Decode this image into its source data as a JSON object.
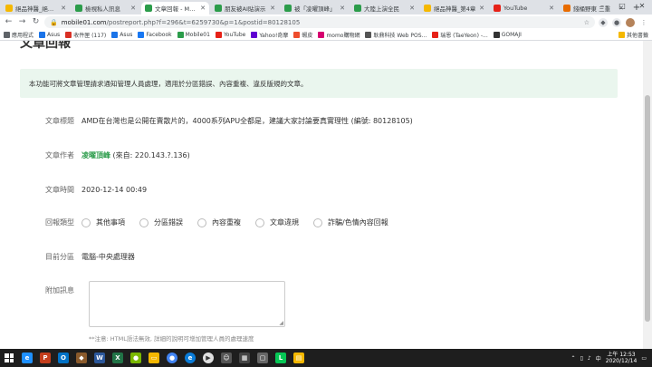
{
  "tabs": [
    {
      "label": "絕品神醫_絕品神醫",
      "color": "#f5b800",
      "active": false
    },
    {
      "label": "檢視私人訊息",
      "color": "#2b9c4a",
      "active": false
    },
    {
      "label": "文章回報 - Mobile01",
      "color": "#2b9c4a",
      "active": true
    },
    {
      "label": "朋友被AI貼演示",
      "color": "#2b9c4a",
      "active": false
    },
    {
      "label": "被「凌曜頂峰」",
      "color": "#2b9c4a",
      "active": false
    },
    {
      "label": "大陸上演全民",
      "color": "#2b9c4a",
      "active": false
    },
    {
      "label": "絕品神醫_第4章",
      "color": "#f5b800",
      "active": false
    },
    {
      "label": "YouTube",
      "color": "#e62117",
      "active": false
    },
    {
      "label": "錢桶野東 三重",
      "color": "#e86c00",
      "active": false
    }
  ],
  "toolbar": {
    "url_domain": "mobile01.com",
    "url_path": "/postreport.php?f=296&t=6259730&p=1&postid=80128105"
  },
  "bookmarks": [
    {
      "label": "應用程式",
      "color": "#5f6368"
    },
    {
      "label": "Asus",
      "color": "#1a73e8"
    },
    {
      "label": "收件匣 (117)",
      "color": "#d93025"
    },
    {
      "label": "Asus",
      "color": "#1a73e8"
    },
    {
      "label": "Facebook",
      "color": "#1877f2"
    },
    {
      "label": "Mobile01",
      "color": "#2b9c4a"
    },
    {
      "label": "YouTube",
      "color": "#e62117"
    },
    {
      "label": "Yahoo!奇摩",
      "color": "#6001d2"
    },
    {
      "label": "蝦皮",
      "color": "#ee4d2d"
    },
    {
      "label": "momo購物網",
      "color": "#d6006f"
    },
    {
      "label": "耿鼎科技 Web POS...",
      "color": "#555"
    },
    {
      "label": "瑞恩 (TaeYeon) -...",
      "color": "#e62117"
    },
    {
      "label": "GOMAJI",
      "color": "#333"
    }
  ],
  "bookmarks_other": "其他書籤",
  "page": {
    "title": "文章回報",
    "notice": "本功能可將文章管理請求通知管理人員處理，適用於分區錯誤、內容重複、違反版規的文章。",
    "fields": {
      "article_title_label": "文章標題",
      "article_title_value": "AMD在台灣也是公開在賣散片的，4000系列APU全都是，建議大家討論要真實理性 (編號: 80128105)",
      "author_label": "文章作者",
      "author_name": "凌曜頂峰",
      "author_ip": " (來自: 220.143.?.136)",
      "time_label": "文章時間",
      "time_value": "2020-12-14 00:49",
      "type_label": "回報類型",
      "types": [
        "其他事項",
        "分區錯誤",
        "內容重複",
        "文章違規",
        "詐騙/色情內容回報"
      ],
      "category_label": "目前分區",
      "category_value": "電腦-中央處理器",
      "extra_label": "附加訊息",
      "note": "**注意: HTML語法無效, 詳細的說明可增加管理人員的處理速度"
    }
  },
  "taskbar": {
    "time": "上午 12:53",
    "date": "2020/12/14"
  }
}
